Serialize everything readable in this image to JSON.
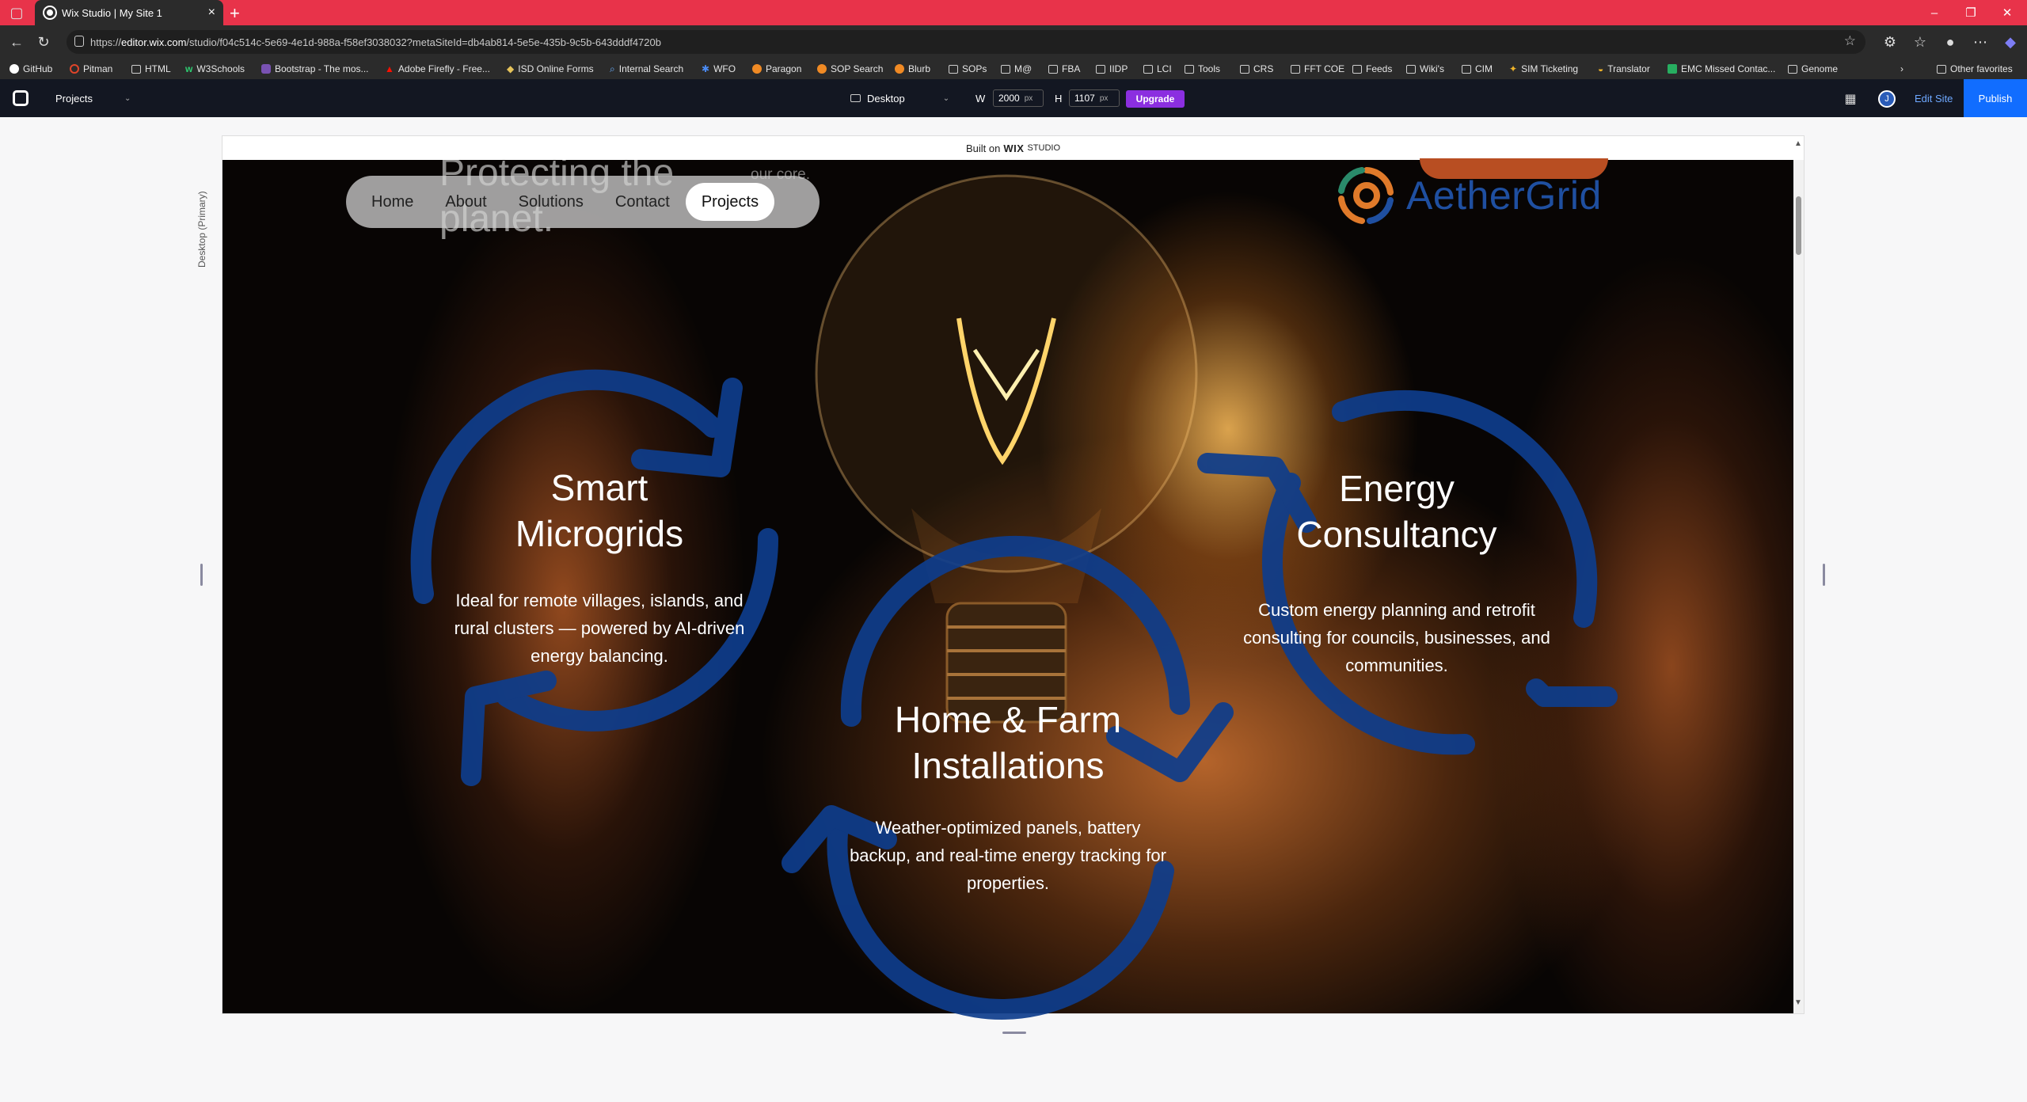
{
  "browser": {
    "tab_title": "Wix Studio | My Site 1",
    "new_tab": "+",
    "url_prefix": "https://",
    "url_host": "editor.wix.com",
    "url_path": "/studio/f04c514c-5e69-4e1d-988a-f58ef3038032?metaSiteId=db4ab814-5e5e-435b-9c5b-643dddf4720b",
    "bookmarks": [
      "GitHub",
      "Pitman",
      "HTML",
      "W3Schools",
      "Bootstrap - The mos...",
      "Adobe Firefly - Free...",
      "ISD Online Forms",
      "Internal Search",
      "WFO",
      "Paragon",
      "SOP Search",
      "Blurb",
      "SOPs",
      "M@",
      "FBA",
      "IIDP",
      "LCI",
      "Tools",
      "CRS",
      "FFT COE",
      "Feeds",
      "Wiki's",
      "CIM",
      "SIM Ticketing",
      "Translator",
      "EMC Missed Contac...",
      "Genome"
    ],
    "other_favorites": "Other favorites"
  },
  "editor": {
    "projects_label": "Projects",
    "device_label": "Desktop",
    "width_label": "W",
    "width_value": "2000",
    "height_label": "H",
    "height_value": "1107",
    "unit": "px",
    "upgrade_label": "Upgrade",
    "avatar_letter": "J",
    "edit_site_label": "Edit Site",
    "publish_label": "Publish",
    "built_on_prefix": "Built on",
    "built_on_brand": "WIX",
    "built_on_suffix": "STUDIO",
    "breakpoint_label": "Desktop (Primary)"
  },
  "site": {
    "nav": [
      "Home",
      "About",
      "Solutions",
      "Contact",
      "Projects"
    ],
    "nav_active": "Projects",
    "bg_title": "Protecting the planet.",
    "bg_core": "our core.",
    "logo_text": "AetherGrid",
    "features": [
      {
        "title_line1": "Smart",
        "title_line2": "Microgrids",
        "description": "Ideal for remote villages, islands, and rural clusters — powered by AI-driven energy balancing."
      },
      {
        "title_line1": "Energy",
        "title_line2": "Consultancy",
        "description": "Custom energy planning and retrofit consulting for councils, businesses, and communities."
      },
      {
        "title_line1": "Home & Farm",
        "title_line2": "Installations",
        "description": "Weather-optimized panels, battery backup, and real-time energy tracking for properties."
      }
    ]
  },
  "colors": {
    "browser_accent": "#e8334a",
    "arrow_blue": "#0e3d8c",
    "logo_blue": "#1f4fa0",
    "logo_orange": "#e07a2a",
    "publish_blue": "#116dff",
    "upgrade_purple": "#8b2fe0"
  }
}
